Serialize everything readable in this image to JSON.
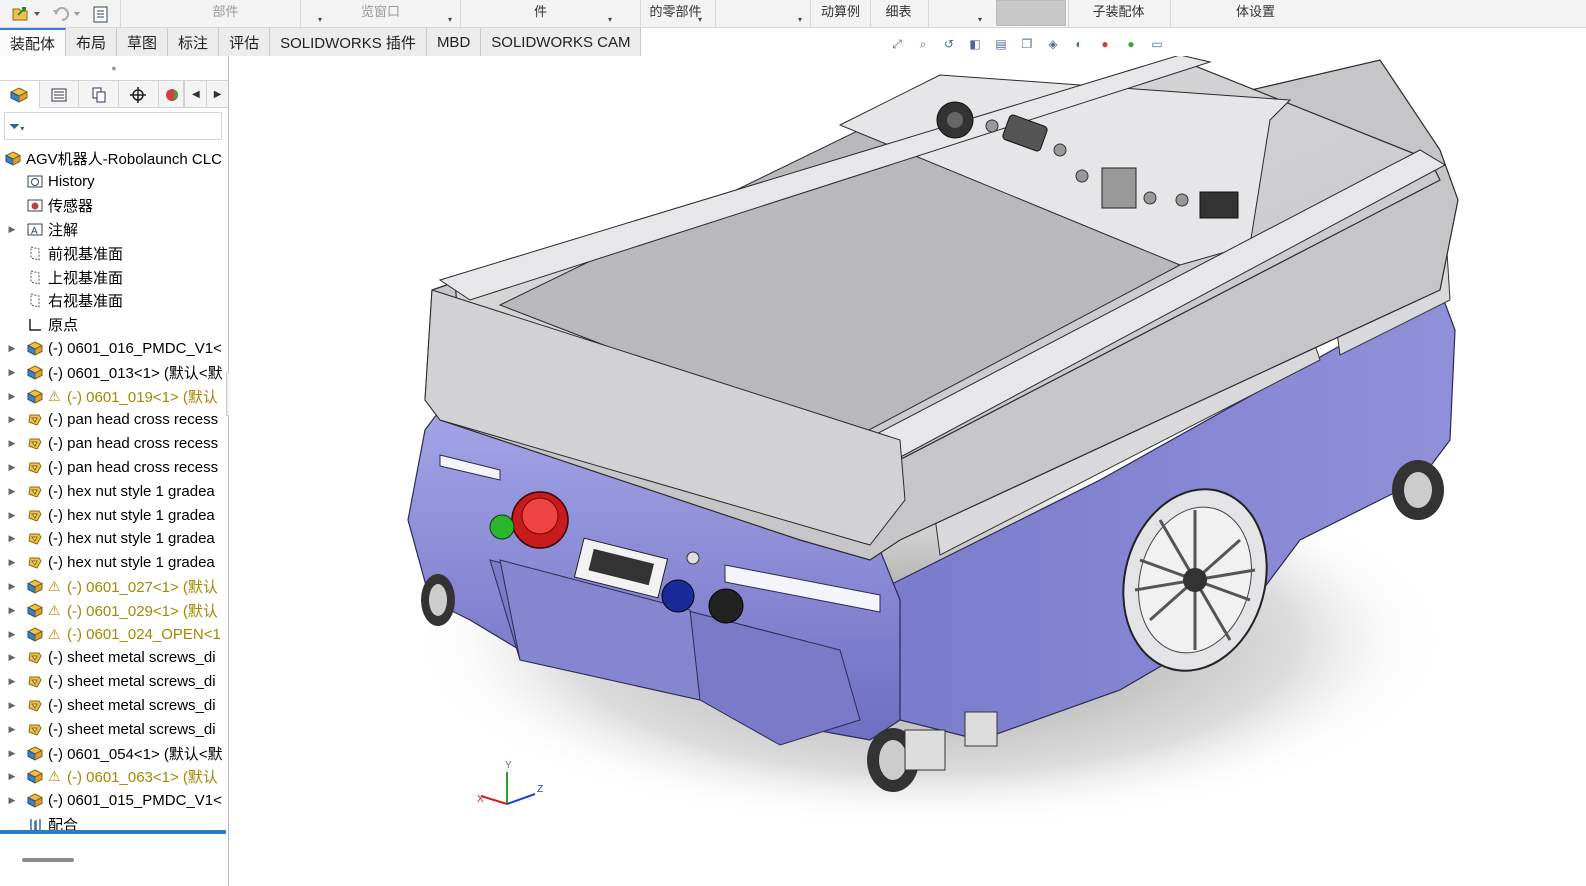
{
  "ribbon": {
    "cells": [
      {
        "label": "部件",
        "faded": true
      },
      {
        "label": "览窗口",
        "faded": true
      },
      {
        "label": "件",
        "faded": false
      },
      {
        "label": "的零部件",
        "faded": false
      },
      {
        "label": "",
        "faded": false
      },
      {
        "label": "动算例",
        "faded": false
      },
      {
        "label": "细表",
        "faded": false
      },
      {
        "label": "",
        "faded": false
      },
      {
        "label": "子装配体",
        "faded": false
      },
      {
        "label": "体设置",
        "faded": false
      }
    ]
  },
  "tabs": [
    {
      "label": "装配体",
      "active": true
    },
    {
      "label": "布局"
    },
    {
      "label": "草图"
    },
    {
      "label": "标注"
    },
    {
      "label": "评估"
    },
    {
      "label": "SOLIDWORKS 插件"
    },
    {
      "label": "MBD"
    },
    {
      "label": "SOLIDWORKS CAM"
    }
  ],
  "feature_manager": {
    "tabs": [
      "featuremanager-icon",
      "propertymanager-icon",
      "configurationmanager-icon",
      "dimxpert-icon",
      "display-manager-icon"
    ],
    "root": "AGV机器人-Robolaunch CLC",
    "items": [
      {
        "label": "History",
        "icon": "history-icon",
        "expand": false,
        "warning": false
      },
      {
        "label": "传感器",
        "icon": "sensor-icon",
        "expand": false,
        "warning": false
      },
      {
        "label": "注解",
        "icon": "annotation-icon",
        "expand": true,
        "warning": false
      },
      {
        "label": "前视基准面",
        "icon": "plane-icon",
        "expand": false,
        "warning": false
      },
      {
        "label": "上视基准面",
        "icon": "plane-icon",
        "expand": false,
        "warning": false
      },
      {
        "label": "右视基准面",
        "icon": "plane-icon",
        "expand": false,
        "warning": false
      },
      {
        "label": "原点",
        "icon": "origin-icon",
        "expand": false,
        "warning": false
      },
      {
        "label": "(-) 0601_016_PMDC_V1<",
        "icon": "assembly-icon",
        "expand": true,
        "warning": false
      },
      {
        "label": "(-) 0601_013<1> (默认<默",
        "icon": "assembly-icon",
        "expand": true,
        "warning": false
      },
      {
        "label": "(-) 0601_019<1> (默认",
        "icon": "assembly-icon",
        "expand": true,
        "warning": true
      },
      {
        "label": "(-) pan head cross recess",
        "icon": "part-icon",
        "expand": true,
        "warning": false
      },
      {
        "label": "(-) pan head cross recess",
        "icon": "part-icon",
        "expand": true,
        "warning": false
      },
      {
        "label": "(-) pan head cross recess",
        "icon": "part-icon",
        "expand": true,
        "warning": false
      },
      {
        "label": "(-) hex nut style 1 gradea",
        "icon": "part-icon",
        "expand": true,
        "warning": false
      },
      {
        "label": "(-) hex nut style 1 gradea",
        "icon": "part-icon",
        "expand": true,
        "warning": false
      },
      {
        "label": "(-) hex nut style 1 gradea",
        "icon": "part-icon",
        "expand": true,
        "warning": false
      },
      {
        "label": "(-) hex nut style 1 gradea",
        "icon": "part-icon",
        "expand": true,
        "warning": false
      },
      {
        "label": "(-) 0601_027<1> (默认",
        "icon": "assembly-icon",
        "expand": true,
        "warning": true
      },
      {
        "label": "(-) 0601_029<1> (默认",
        "icon": "assembly-icon",
        "expand": true,
        "warning": true
      },
      {
        "label": "(-) 0601_024_OPEN<1",
        "icon": "assembly-icon",
        "expand": true,
        "warning": true
      },
      {
        "label": "(-) sheet metal screws_di",
        "icon": "part-icon",
        "expand": true,
        "warning": false
      },
      {
        "label": "(-) sheet metal screws_di",
        "icon": "part-icon",
        "expand": true,
        "warning": false
      },
      {
        "label": "(-) sheet metal screws_di",
        "icon": "part-icon",
        "expand": true,
        "warning": false
      },
      {
        "label": "(-) sheet metal screws_di",
        "icon": "part-icon",
        "expand": true,
        "warning": false
      },
      {
        "label": "(-) 0601_054<1> (默认<默",
        "icon": "assembly-icon",
        "expand": true,
        "warning": false
      },
      {
        "label": "(-) 0601_063<1> (默认",
        "icon": "assembly-icon",
        "expand": true,
        "warning": true
      },
      {
        "label": "(-) 0601_015_PMDC_V1<",
        "icon": "assembly-icon",
        "expand": true,
        "warning": false
      },
      {
        "label": "配合",
        "icon": "mates-icon",
        "expand": false,
        "warning": false
      }
    ]
  },
  "triad": {
    "x": "X",
    "y": "Y",
    "z": "Z"
  },
  "colors": {
    "body_purple": "#8f8fd8",
    "shell_gray": "#c9c9cc",
    "accent_blue": "#2f7ec4",
    "estop_red": "#c81c1c"
  }
}
